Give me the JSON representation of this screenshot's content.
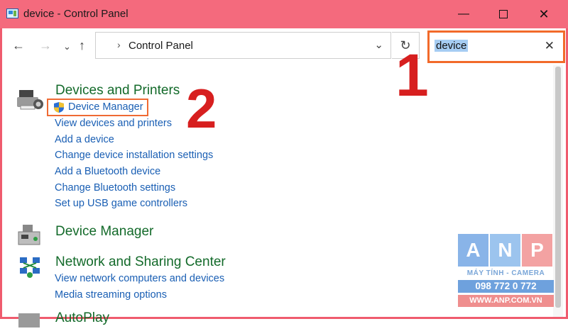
{
  "window": {
    "title": "device - Control Panel",
    "minimize_icon": "—",
    "close_icon": "✕"
  },
  "addressbar": {
    "back_icon": "←",
    "forward_icon": "→",
    "recent_icon": "⌄",
    "up_icon": "↑",
    "breadcrumb_separator": "›",
    "breadcrumb": "Control Panel",
    "dropdown_icon": "⌄",
    "refresh_icon": "↻"
  },
  "search": {
    "value": "device",
    "clear_icon": "✕"
  },
  "annotations": {
    "step1": "1",
    "step2": "2",
    "highlight_color": "#f26a2a",
    "number_color": "#d71f1f"
  },
  "results": [
    {
      "title": "Devices and Printers",
      "highlighted_link": "Device Manager",
      "links": [
        "View devices and printers",
        "Add a device",
        "Change device installation settings",
        "Add a Bluetooth device",
        "Change Bluetooth settings",
        "Set up USB game controllers"
      ]
    },
    {
      "title": "Device Manager",
      "links": []
    },
    {
      "title": "Network and Sharing Center",
      "links": [
        "View network computers and devices",
        "Media streaming options"
      ]
    },
    {
      "title": "AutoPlay",
      "links": []
    }
  ],
  "watermark": {
    "letters": [
      "A",
      "N",
      "P"
    ],
    "subtitle": "MÁY TÍNH - CAMERA",
    "phone": "098 772 0 772",
    "website": "WWW.ANP.COM.VN"
  },
  "colors": {
    "titlebar": "#f46a7d",
    "category_title": "#136a2a",
    "link": "#1a5fb4"
  }
}
